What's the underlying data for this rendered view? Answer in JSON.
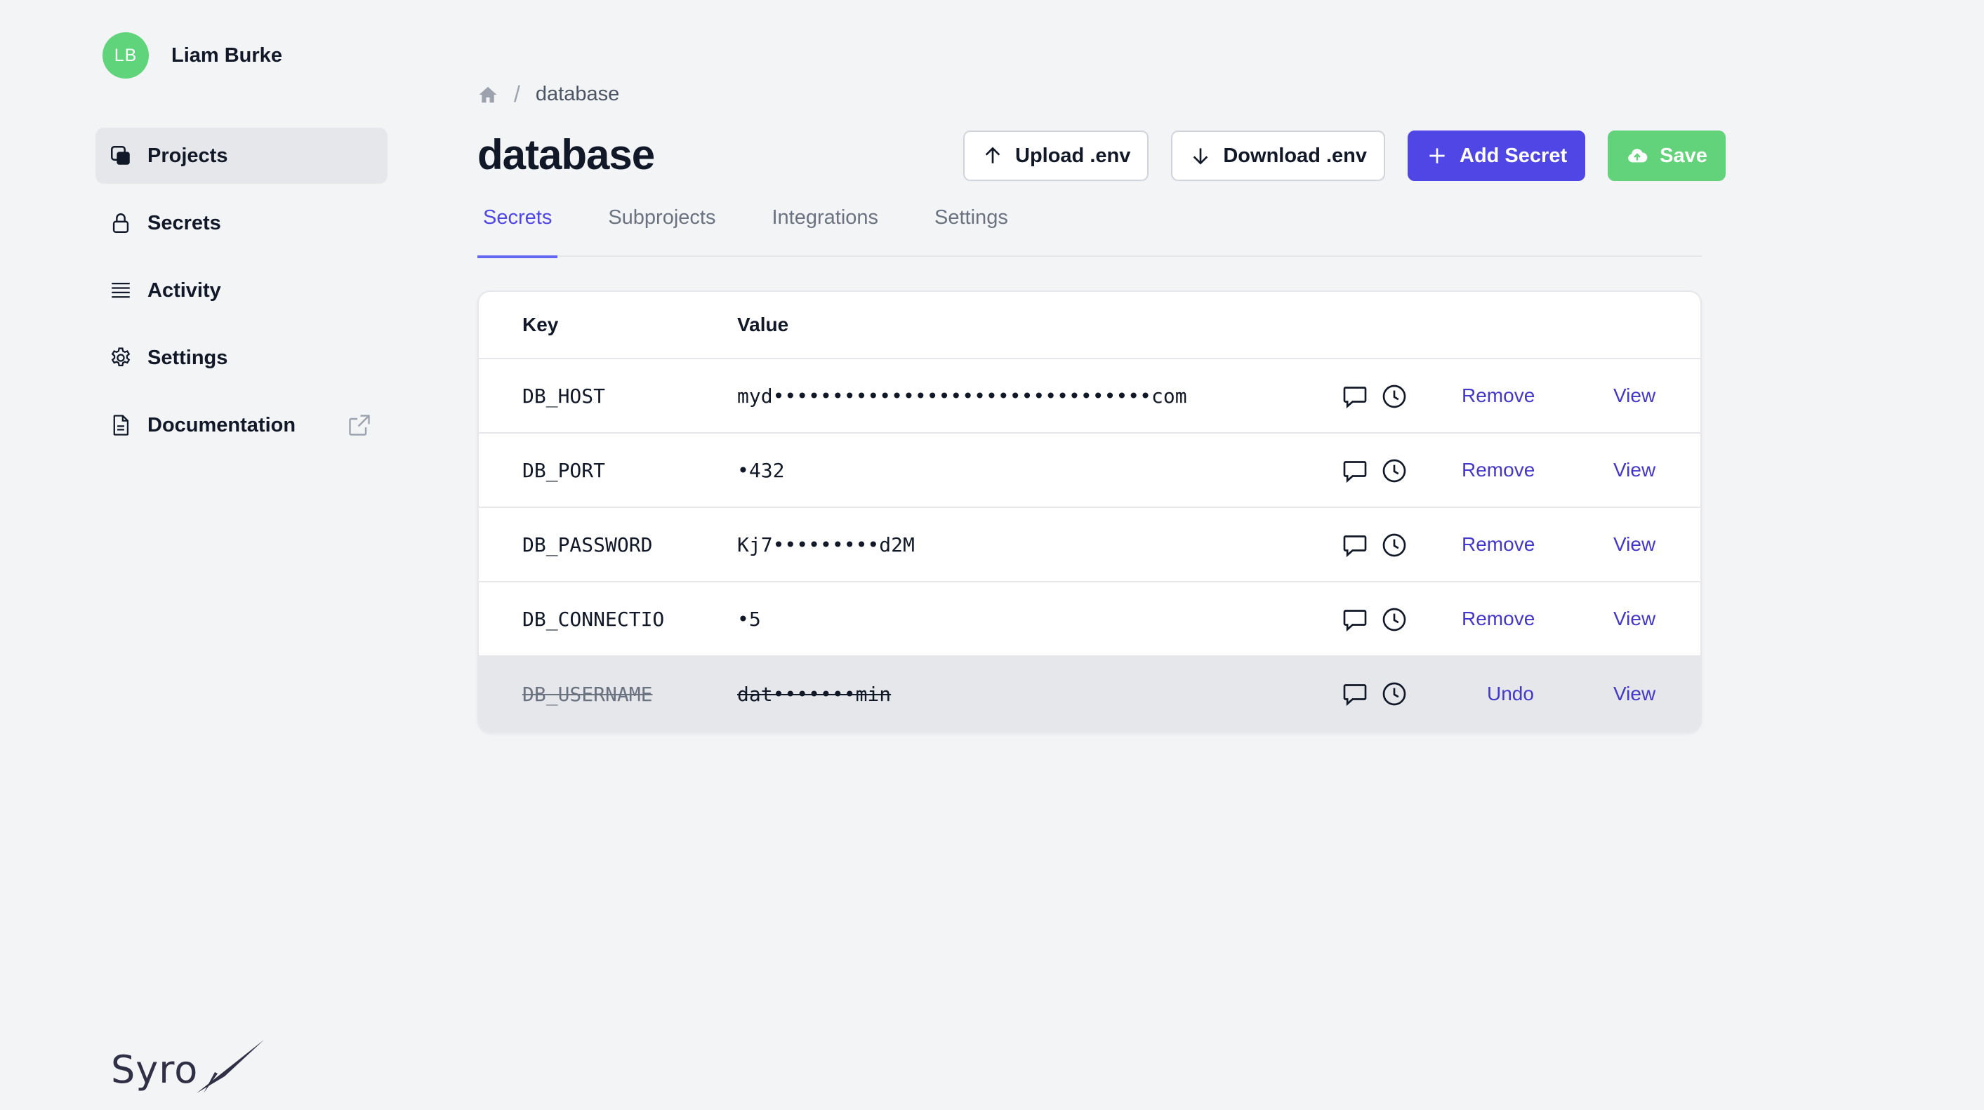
{
  "user": {
    "initials": "LB",
    "name": "Liam Burke"
  },
  "sidebar": {
    "items": [
      {
        "label": "Projects",
        "icon": "projects-icon",
        "active": true
      },
      {
        "label": "Secrets",
        "icon": "lock-icon"
      },
      {
        "label": "Activity",
        "icon": "list-icon"
      },
      {
        "label": "Settings",
        "icon": "gear-icon"
      },
      {
        "label": "Documentation",
        "icon": "document-icon",
        "external": true
      }
    ]
  },
  "brand": {
    "logo_text": "Syro",
    "accent": "#4f46e5",
    "save_color": "#62d37a"
  },
  "breadcrumb": {
    "current": "database"
  },
  "page": {
    "title": "database"
  },
  "toolbar": {
    "upload_label": "Upload .env",
    "download_label": "Download .env",
    "add_label": "Add Secret",
    "save_label": "Save"
  },
  "tabs": [
    {
      "label": "Secrets",
      "active": true
    },
    {
      "label": "Subprojects"
    },
    {
      "label": "Integrations"
    },
    {
      "label": "Settings"
    }
  ],
  "table": {
    "headers": {
      "key": "Key",
      "value": "Value"
    },
    "rows": [
      {
        "key": "DB_HOST",
        "value": "myd••••••••••••••••••••••••••••••••com",
        "action": "Remove",
        "view": "View",
        "deleted": false
      },
      {
        "key": "DB_PORT",
        "value": "•432",
        "action": "Remove",
        "view": "View",
        "deleted": false
      },
      {
        "key": "DB_PASSWORD",
        "value": "Kj7•••••••••d2M",
        "action": "Remove",
        "view": "View",
        "deleted": false
      },
      {
        "key": "DB_CONNECTIO",
        "value": "•5",
        "action": "Remove",
        "view": "View",
        "deleted": false
      },
      {
        "key": "DB_USERNAME",
        "value": "dat•••••••min",
        "action": "Undo",
        "view": "View",
        "deleted": true
      }
    ]
  }
}
